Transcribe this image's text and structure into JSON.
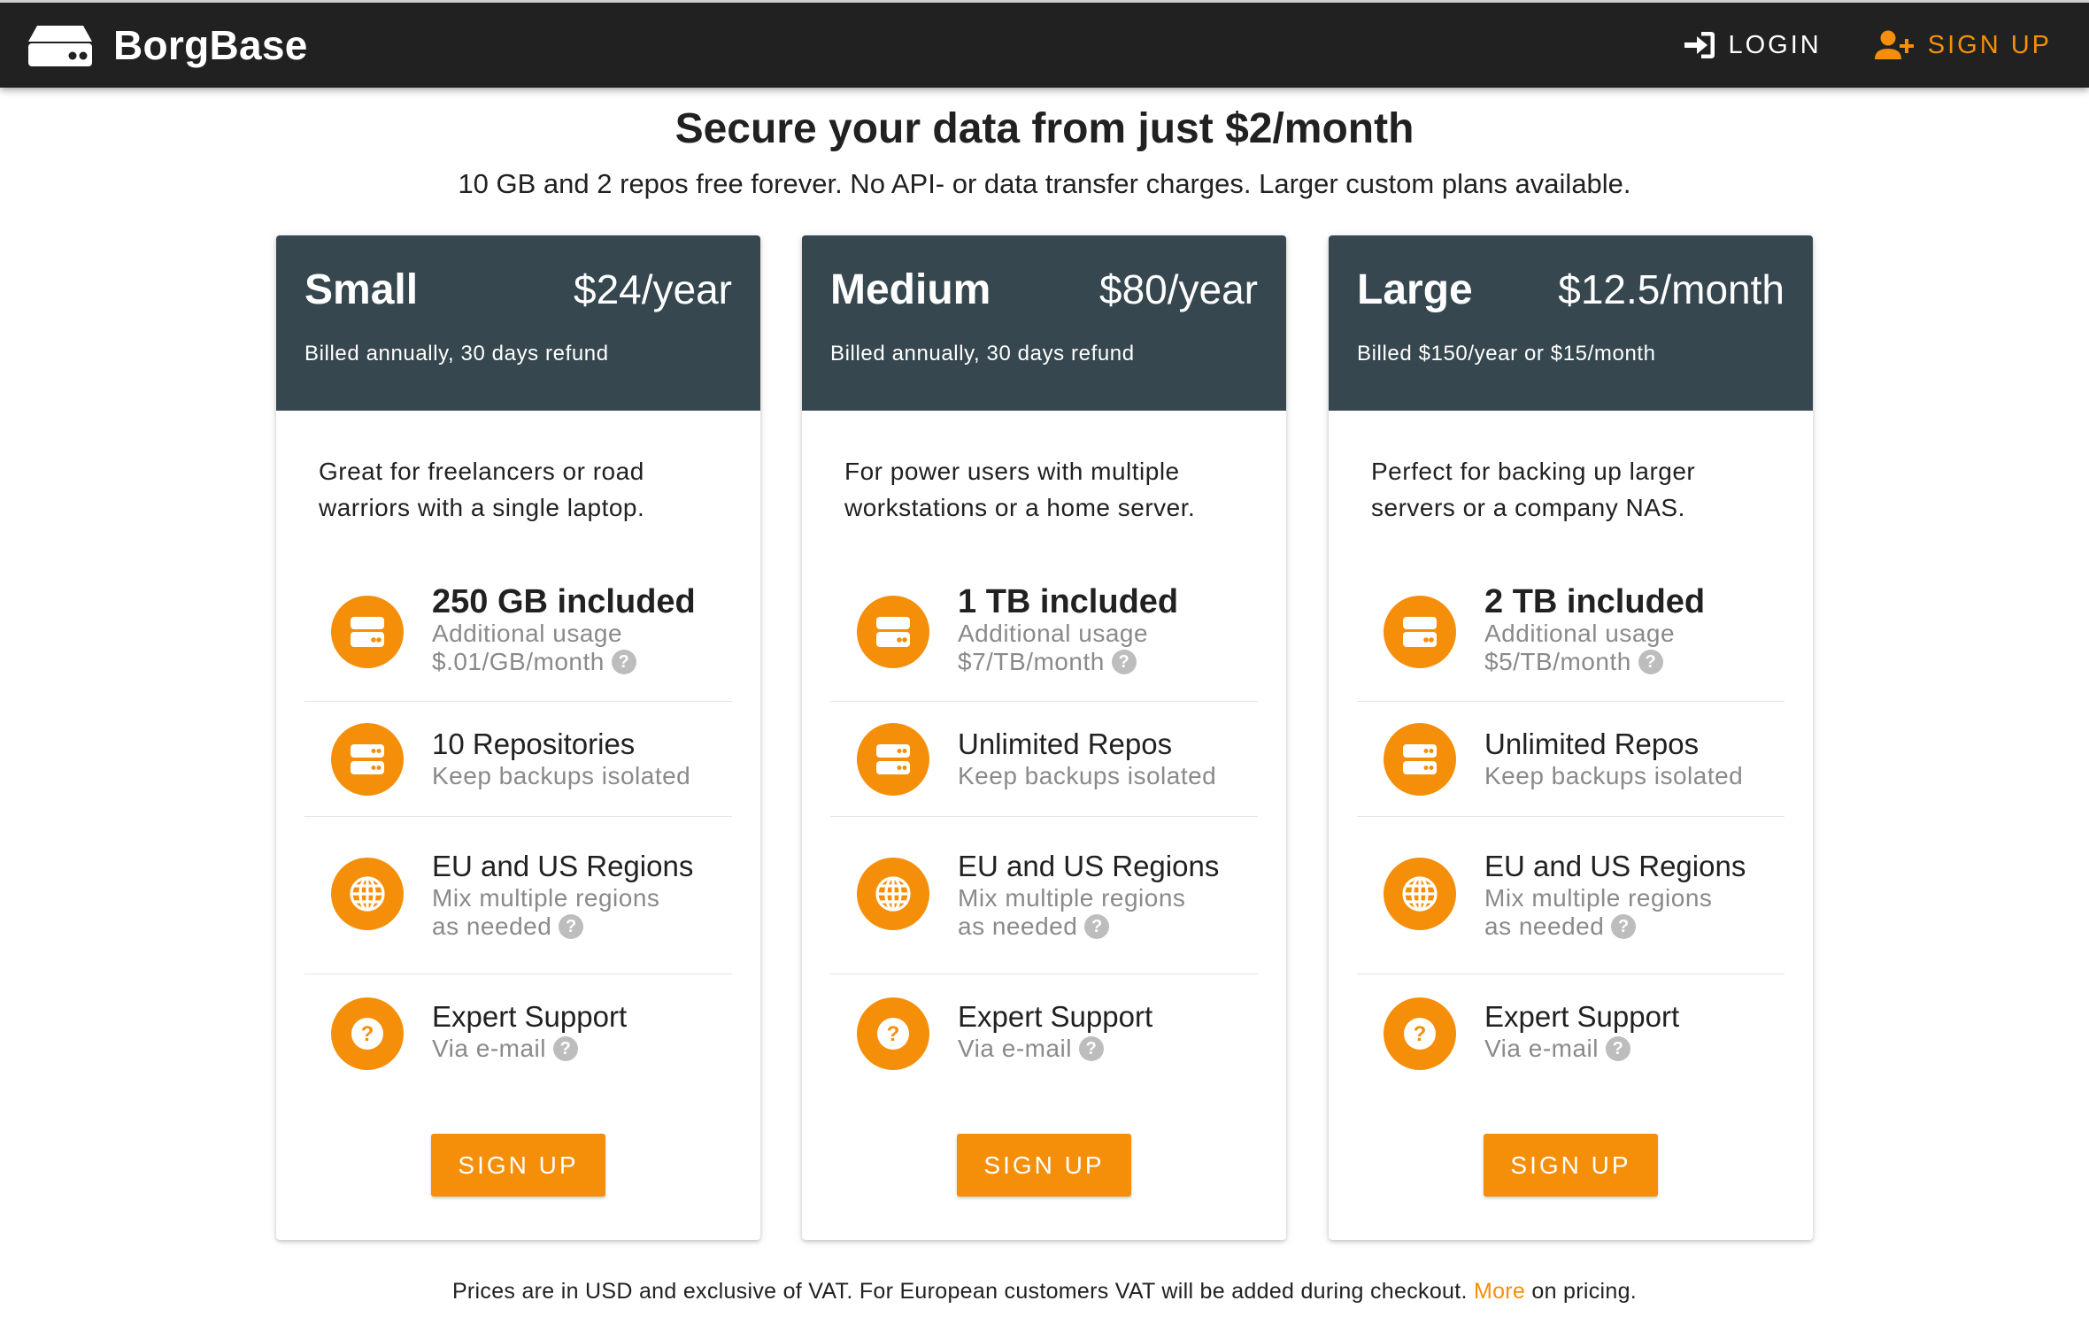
{
  "nav": {
    "brand": "BorgBase",
    "login_label": "Login",
    "signup_label": "Sign up"
  },
  "hero": {
    "title": "Secure your data from just $2/month",
    "subtitle": "10 GB and 2 repos free forever. No API- or data transfer charges. Larger custom plans available."
  },
  "colors": {
    "accent": "#f58f0a",
    "card_header": "#37474f",
    "navbar": "#212121"
  },
  "plans": [
    {
      "name": "Small",
      "price": "$24/year",
      "billing": "Billed annually, 30 days refund",
      "description": "Great for freelancers or road warriors with a single laptop.",
      "storage_title": "250 GB included",
      "storage_sub1": "Additional usage",
      "storage_sub2": "$.01/GB/month",
      "repos_title": "10 Repositories",
      "repos_sub": "Keep backups isolated",
      "regions_title": "EU and US Regions",
      "regions_sub1": "Mix multiple regions",
      "regions_sub2": "as needed",
      "support_title": "Expert Support",
      "support_sub": "Via e-mail",
      "cta": "Sign up"
    },
    {
      "name": "Medium",
      "price": "$80/year",
      "billing": "Billed annually, 30 days refund",
      "description": "For power users with multiple workstations or a home server.",
      "storage_title": "1 TB included",
      "storage_sub1": "Additional usage",
      "storage_sub2": "$7/TB/month",
      "repos_title": "Unlimited Repos",
      "repos_sub": "Keep backups isolated",
      "regions_title": "EU and US Regions",
      "regions_sub1": "Mix multiple regions",
      "regions_sub2": "as needed",
      "support_title": "Expert Support",
      "support_sub": "Via e-mail",
      "cta": "Sign up"
    },
    {
      "name": "Large",
      "price": "$12.5/month",
      "billing": "Billed $150/year or $15/month",
      "description": "Perfect for backing up larger servers or a company NAS.",
      "storage_title": "2 TB included",
      "storage_sub1": "Additional usage",
      "storage_sub2": "$5/TB/month",
      "repos_title": "Unlimited Repos",
      "repos_sub": "Keep backups isolated",
      "regions_title": "EU and US Regions",
      "regions_sub1": "Mix multiple regions",
      "regions_sub2": "as needed",
      "support_title": "Expert Support",
      "support_sub": "Via e-mail",
      "cta": "Sign up"
    }
  ],
  "icons": {
    "brand": "hard-drive-icon",
    "login": "login-icon",
    "signup": "account-plus-icon",
    "storage": "harddisk-icon",
    "repos": "server-icon",
    "regions": "globe-icon",
    "support": "help-circle-icon",
    "help": "help-icon"
  },
  "help_glyph": "?",
  "footer": {
    "text_before": "Prices are in USD and exclusive of VAT. For European customers VAT will be added during checkout.",
    "link": "More",
    "text_after": "on pricing."
  }
}
